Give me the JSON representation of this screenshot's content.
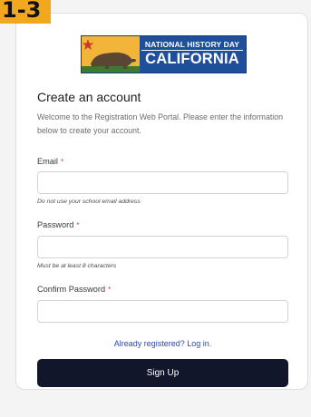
{
  "badge": {
    "text": "1-3"
  },
  "logo": {
    "line1": "NATIONAL HISTORY DAY",
    "line2": "CALIFORNIA",
    "colors": {
      "background": "#1f4e9b",
      "sky": "#f2b53a",
      "bear": "#5a4632",
      "ground": "#3b7a32",
      "star": "#c83a2a"
    }
  },
  "form": {
    "title": "Create an account",
    "subtitle": "Welcome to the Registration Web Portal. Please enter the information below to create your account.",
    "required_marker": "*",
    "email": {
      "label": "Email",
      "value": "",
      "placeholder": "",
      "hint": "Do not use your school email address"
    },
    "password": {
      "label": "Password",
      "value": "",
      "placeholder": "",
      "hint": "Must be at least 8 characters"
    },
    "confirm_password": {
      "label": "Confirm Password",
      "value": "",
      "placeholder": ""
    },
    "login_link": "Already registered? Log in.",
    "submit": "Sign Up"
  },
  "colors": {
    "accent_badge": "#f2a81d",
    "button": "#11162a",
    "link": "#2d47a8",
    "required": "#e53935"
  }
}
